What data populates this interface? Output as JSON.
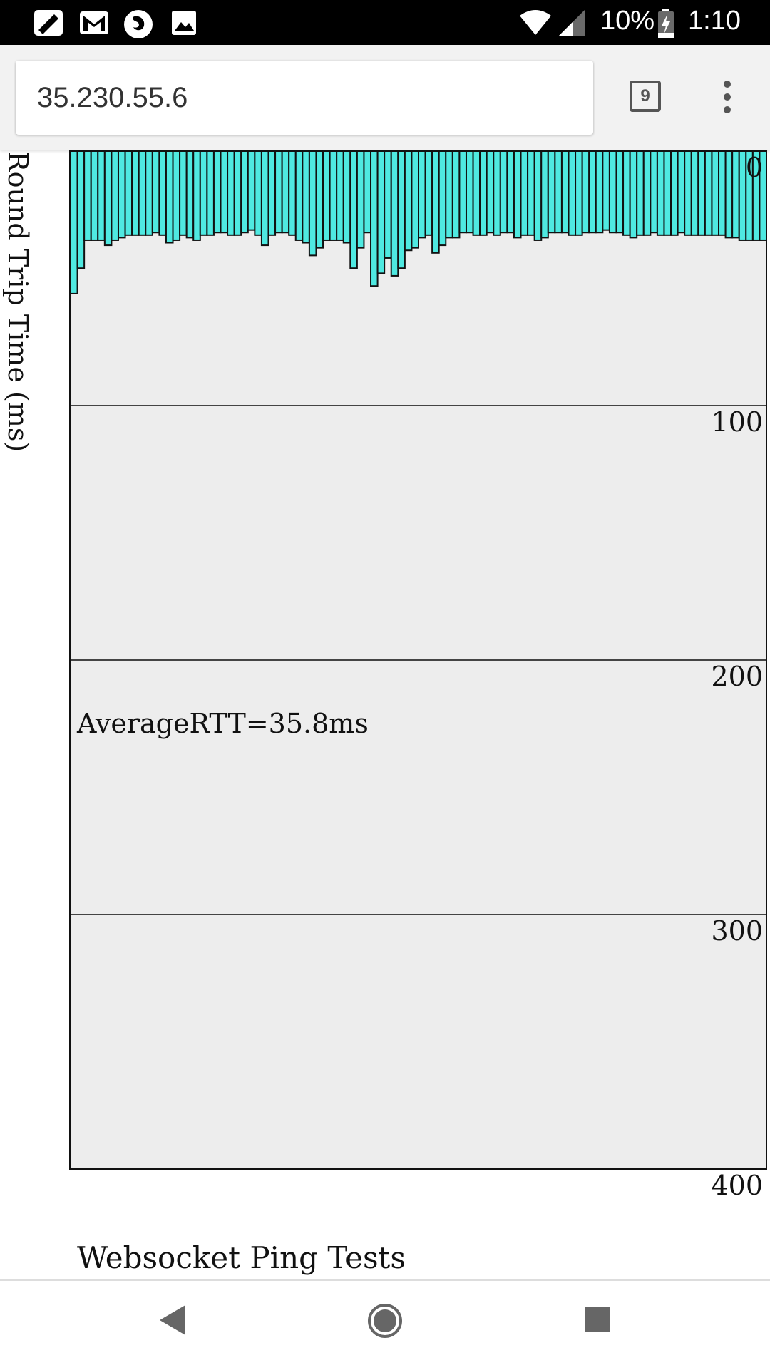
{
  "status_bar": {
    "icons": [
      "notification-icon",
      "gmail-icon",
      "firefox-icon",
      "image-icon",
      "wifi-icon",
      "signal-icon",
      "battery-charging-icon"
    ],
    "battery": "10%",
    "time": "1:10"
  },
  "browser": {
    "url": "35.230.55.6",
    "tab_count": "9",
    "menu_icon": "more-vert-icon"
  },
  "page": {
    "heading": "Websocket Ping Tests",
    "average_label": "AverageRTT=35.8ms"
  },
  "chart_data": {
    "type": "bar",
    "ylabel": "Round Trip Time (ms)",
    "ylim": [
      0,
      400
    ],
    "yticks": [
      "0",
      "100",
      "200",
      "300",
      "400"
    ],
    "grid": true,
    "bar_color": "#4fe9e1",
    "plot_background": "#ededed",
    "values": [
      56,
      46,
      35,
      35,
      35,
      37,
      35,
      34,
      33,
      33,
      33,
      33,
      32,
      33,
      36,
      35,
      33,
      34,
      35,
      33,
      33,
      32,
      32,
      33,
      33,
      32,
      31,
      33,
      37,
      33,
      32,
      32,
      33,
      35,
      36,
      41,
      38,
      35,
      35,
      35,
      36,
      46,
      38,
      32,
      53,
      48,
      42,
      49,
      46,
      39,
      38,
      34,
      33,
      40,
      37,
      34,
      34,
      32,
      32,
      33,
      33,
      32,
      33,
      32,
      32,
      34,
      33,
      33,
      35,
      34,
      32,
      32,
      32,
      33,
      33,
      32,
      32,
      32,
      31,
      32,
      32,
      33,
      34,
      33,
      33,
      32,
      33,
      33,
      33,
      32,
      33,
      33,
      33,
      33,
      33,
      33,
      34,
      34,
      35,
      35,
      35,
      35
    ]
  },
  "nav": {
    "back": "back-icon",
    "home": "home-icon",
    "recents": "recents-icon"
  }
}
